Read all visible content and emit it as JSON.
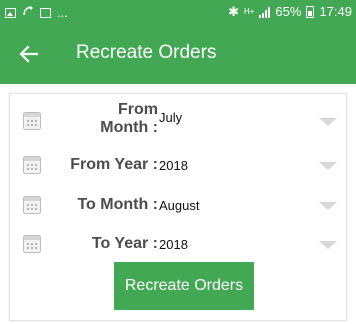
{
  "status_bar": {
    "bluetooth_glyph": "✱",
    "network_label": "H+",
    "battery_percent": "65%",
    "time": "17:49",
    "overflow": "..."
  },
  "app_bar": {
    "title": "Recreate Orders",
    "back_icon": "arrow-left-icon",
    "color": "#43a854"
  },
  "form": {
    "fields": [
      {
        "label": "From Month :",
        "label_line1": "From",
        "label_line2": "Month :",
        "value": "July",
        "icon": "calendar-icon"
      },
      {
        "label": "From Year :",
        "value": "2018",
        "icon": "calendar-icon"
      },
      {
        "label": "To Month :",
        "value": "August",
        "icon": "calendar-icon"
      },
      {
        "label": "To Year :",
        "value": "2018",
        "icon": "calendar-icon"
      }
    ],
    "submit_label": "Recreate Orders"
  }
}
